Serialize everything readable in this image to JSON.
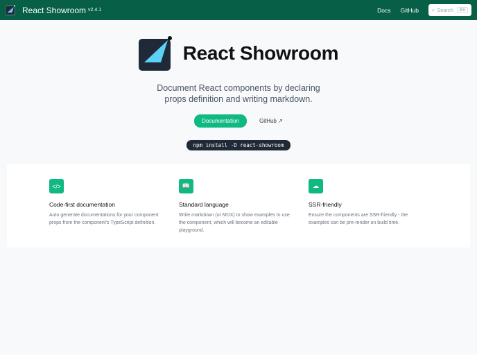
{
  "nav": {
    "title": "React Showroom",
    "version": "v2.4.1",
    "links": [
      "Docs",
      "GitHub"
    ],
    "search_placeholder": "Search",
    "shortcut": "⌘K"
  },
  "hero": {
    "title": "React Showroom",
    "description": "Document React components by declaring props definition and writing markdown.",
    "primary_button": "Documentation",
    "secondary_button": "GitHub",
    "install_command": "npm install -D react-showroom"
  },
  "features": [
    {
      "icon": "code-icon",
      "title": "Code-first documentation",
      "text": "Auto generate documentations for your component props from the component's TypeScript definition."
    },
    {
      "icon": "book-icon",
      "title": "Standard language",
      "text": "Write markdown (or MDX) to show examples to use the component, which will become an editable playground."
    },
    {
      "icon": "cloud-download-icon",
      "title": "SSR-friendly",
      "text": "Ensure the components are SSR-friendly - the examples can be pre-render on build time."
    }
  ]
}
